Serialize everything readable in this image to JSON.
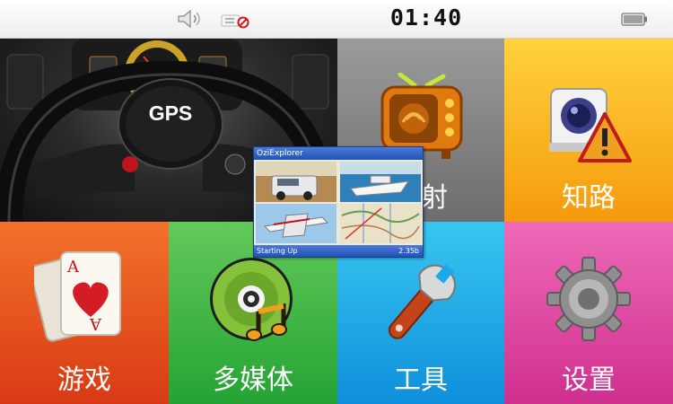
{
  "status_bar": {
    "time": "01:40",
    "icons": [
      "speaker-icon",
      "no-signal-icon",
      "battery-icon"
    ]
  },
  "tiles": [
    {
      "name": "gps",
      "label": "GPS",
      "color": "#222222",
      "icon": "steering-wheel-icon"
    },
    {
      "name": "transmit",
      "label": "发射",
      "color": "#8a8a8a",
      "icon": "tv-icon"
    },
    {
      "name": "road-info",
      "label": "知路",
      "color": "#f9b520",
      "icon": "camera-warning-icon"
    },
    {
      "name": "games",
      "label": "游戏",
      "color": "#e45220",
      "icon": "playing-card-icon"
    },
    {
      "name": "multimedia",
      "label": "多媒体",
      "color": "#3bb446",
      "icon": "music-disc-icon"
    },
    {
      "name": "tools",
      "label": "工具",
      "color": "#1aa8e8",
      "icon": "wrench-icon"
    },
    {
      "name": "settings",
      "label": "设置",
      "color": "#e04aa4",
      "icon": "gear-icon"
    }
  ],
  "splash": {
    "title": "OziExplorer",
    "status": "Starting Up",
    "version": "2.35b"
  }
}
